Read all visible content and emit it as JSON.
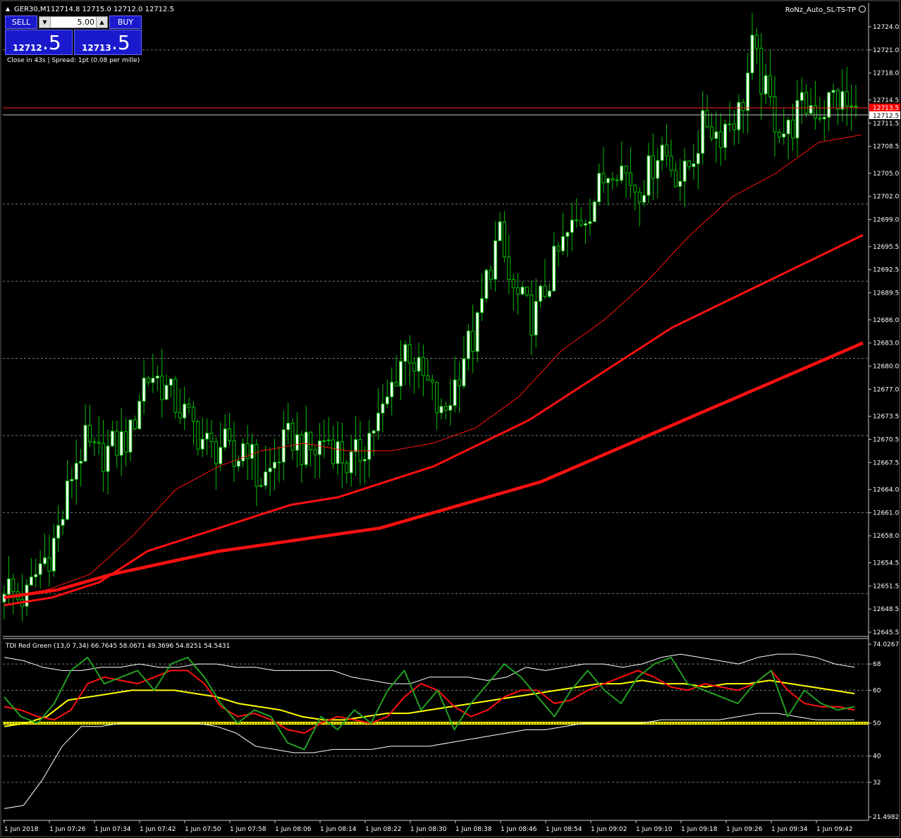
{
  "header": {
    "symbol": "GER30,M1",
    "ohlc": "12714.8 12715.0 12712.0 12712.5",
    "expert": "RoNz_Auto_SL-TS-TP"
  },
  "trade_panel": {
    "sell_label": "SELL",
    "buy_label": "BUY",
    "lot": "5.00",
    "sell_small": "12712",
    "sell_big": ".5",
    "buy_small": "12713",
    "buy_big": ".5",
    "info": "Close in 43s  |  Spread: 1pt (0.08 per mille)"
  },
  "colors": {
    "background": "#000000",
    "bull_candle": "#ffffff",
    "bear_candle": "#00c000",
    "ma": "#ff0000",
    "tdi_green": "#22a022",
    "tdi_red": "#ff1010",
    "tdi_yellow": "#ffff00",
    "tdi_band": "#ffffff"
  },
  "chart_data": [
    {
      "type": "candlestick",
      "symbol": "GER30",
      "timeframe": "M1",
      "y_axis_ticks": [
        "12724.0",
        "12721.0",
        "12718.0",
        "12714.5",
        "12711.5",
        "12708.5",
        "12705.0",
        "12702.0",
        "12699.0",
        "12695.5",
        "12692.5",
        "12689.5",
        "12686.0",
        "12683.0",
        "12680.0",
        "12677.0",
        "12673.5",
        "12670.5",
        "12667.5",
        "12664.0",
        "12661.0",
        "12658.0",
        "12654.5",
        "12651.5",
        "12648.5",
        "12645.5"
      ],
      "ylim": [
        12644.5,
        12725.5
      ],
      "current_price": "12712.5",
      "red_line_level": 12713.5,
      "red_line_label": "12713.5",
      "dashed_grid_levels": [
        12721.0,
        12701.0,
        12691.0,
        12681.0,
        12671.0,
        12661.0,
        12650.5
      ],
      "x_axis_labels": [
        "1 Jun 2018",
        "1 Jun 07:26",
        "1 Jun 07:34",
        "1 Jun 07:42",
        "1 Jun 07:50",
        "1 Jun 07:58",
        "1 Jun 08:06",
        "1 Jun 08:14",
        "1 Jun 08:22",
        "1 Jun 08:30",
        "1 Jun 08:38",
        "1 Jun 08:46",
        "1 Jun 08:54",
        "1 Jun 09:02",
        "1 Jun 09:10",
        "1 Jun 09:18",
        "1 Jun 09:26",
        "1 Jun 09:34",
        "1 Jun 09:42"
      ],
      "close_path": [
        12652,
        12650,
        12650,
        12654,
        12656,
        12660,
        12667,
        12670,
        12668,
        12669,
        12670,
        12671,
        12678,
        12679,
        12677,
        12675,
        12673,
        12671,
        12669,
        12670,
        12667,
        12671,
        12665,
        12666,
        12669,
        12671,
        12669,
        12669,
        12671,
        12669,
        12667,
        12669,
        12672,
        12674,
        12679,
        12683,
        12679,
        12677,
        12673,
        12677,
        12682,
        12684,
        12692,
        12697,
        12690,
        12688,
        12686,
        12690,
        12694,
        12697,
        12699,
        12701,
        12704,
        12707,
        12705,
        12703,
        12705,
        12709,
        12706,
        12704,
        12708,
        12712,
        12710,
        12712,
        12713,
        12721,
        12716,
        12712,
        12710,
        12713,
        12714,
        12713,
        12715,
        12714,
        12712.5
      ],
      "moving_averages": [
        {
          "description": "thin red MA",
          "values": [
            12650,
            12651,
            12653,
            12658,
            12664,
            12667,
            12669,
            12670,
            12669,
            12669,
            12670,
            12672,
            12676,
            12682,
            12686,
            12691,
            12697,
            12702,
            12705,
            12709,
            12710
          ]
        },
        {
          "description": "medium red MA",
          "values": [
            12649,
            12650,
            12652,
            12656,
            12658,
            12660,
            12662,
            12663,
            12665,
            12667,
            12670,
            12673,
            12677,
            12681,
            12685,
            12688,
            12691,
            12694,
            12697
          ]
        },
        {
          "description": "thick red MA",
          "values": [
            12650,
            12651,
            12653,
            12654.5,
            12656,
            12657,
            12658,
            12659,
            12661,
            12663,
            12665,
            12668,
            12671,
            12674,
            12677,
            12680,
            12683
          ]
        }
      ]
    },
    {
      "type": "line",
      "indicator": "TDI Red Green",
      "label": "TDI Red Green (13,0 7,34) 66.7645 58.0671 49.3696 54.8251 54.5431",
      "params": "13,0 7,34",
      "readout_values": [
        66.7645,
        58.0671,
        49.3696,
        54.8251,
        54.5431
      ],
      "y_axis_ticks": [
        "74.0267",
        "68",
        "60",
        "50",
        "40",
        "32",
        "21.4982"
      ],
      "ylim": [
        21.4982,
        74.0267
      ],
      "level_line": 50,
      "series": [
        {
          "color": "white",
          "role": "upper band",
          "values": [
            70,
            69,
            67,
            66,
            66,
            67,
            67,
            68,
            67,
            67,
            68,
            68,
            67,
            67,
            66,
            66,
            66,
            66,
            64,
            63,
            62,
            62,
            64,
            64,
            64,
            63,
            64,
            67,
            66,
            67,
            68,
            68,
            67,
            68,
            70,
            71,
            70,
            69,
            68,
            70,
            71,
            71,
            70,
            68,
            67
          ]
        },
        {
          "color": "white",
          "role": "lower band",
          "values": [
            24,
            25,
            33,
            43,
            49,
            49,
            50,
            50,
            50,
            50,
            50,
            49,
            47,
            43,
            42,
            41,
            41,
            42,
            42,
            42,
            43,
            43,
            43,
            44,
            45,
            46,
            47,
            48,
            48,
            49,
            50,
            50,
            50,
            50,
            51,
            51,
            51,
            51,
            52,
            53,
            53,
            52,
            51,
            51,
            51
          ]
        },
        {
          "color": "yellow",
          "role": "market base line",
          "values": [
            49,
            50,
            52,
            57,
            58,
            59,
            60,
            60,
            60,
            59,
            58,
            56,
            55,
            54,
            52,
            51,
            51,
            52,
            53,
            53,
            54,
            55,
            56,
            57,
            58,
            59,
            60,
            61,
            62,
            62,
            63,
            62,
            62,
            61,
            62,
            62,
            63,
            62,
            61,
            60,
            59
          ]
        },
        {
          "color": "red",
          "role": "signal line",
          "values": [
            55,
            54,
            52,
            51,
            54,
            62,
            64,
            63,
            62,
            64,
            66,
            66,
            62,
            55,
            52,
            53,
            51,
            48,
            47,
            50,
            52,
            51,
            50,
            52,
            58,
            62,
            60,
            55,
            52,
            54,
            58,
            60,
            60,
            56,
            57,
            60,
            62,
            64,
            66,
            64,
            61,
            60,
            62,
            61,
            60,
            62,
            66,
            60,
            56,
            55,
            55,
            54
          ]
        },
        {
          "color": "green",
          "role": "RSI price line",
          "values": [
            58,
            52,
            50,
            56,
            66,
            70,
            62,
            64,
            66,
            60,
            68,
            70,
            64,
            56,
            50,
            54,
            52,
            44,
            42,
            52,
            48,
            54,
            50,
            60,
            66,
            54,
            60,
            48,
            56,
            62,
            68,
            64,
            58,
            52,
            60,
            66,
            60,
            56,
            64,
            68,
            70,
            62,
            60,
            58,
            56,
            62,
            66,
            52,
            60,
            56,
            54,
            55
          ]
        }
      ]
    }
  ]
}
